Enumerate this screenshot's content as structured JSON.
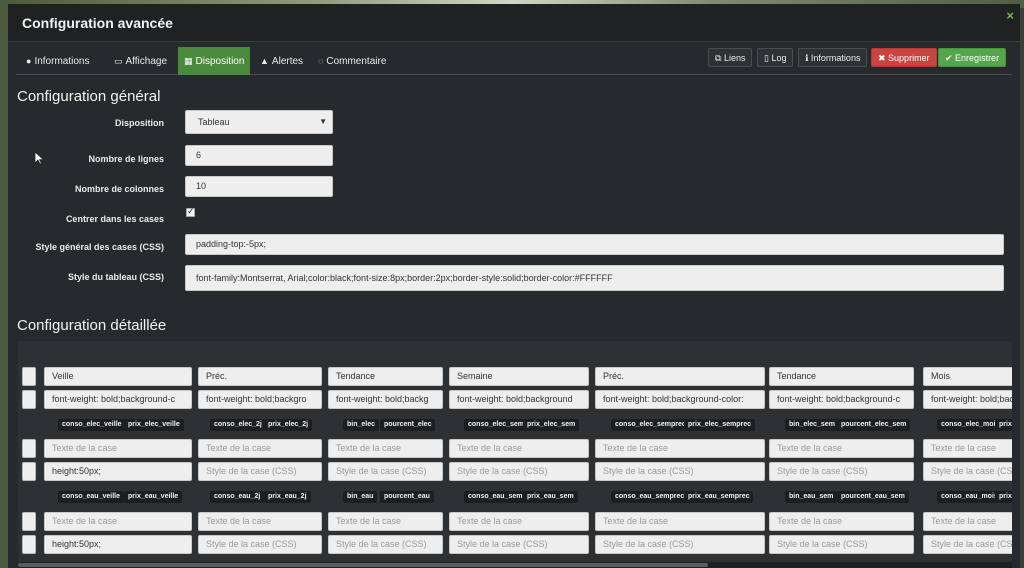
{
  "modal": {
    "title": "Configuration avancée",
    "close_glyph": "×"
  },
  "tabs": [
    {
      "icon": "info-circle-icon",
      "glyph": "●",
      "label": "Informations"
    },
    {
      "icon": "monitor-icon",
      "glyph": "▭",
      "label": "Affichage"
    },
    {
      "icon": "grid-icon",
      "glyph": "▦",
      "label": "Disposition"
    },
    {
      "icon": "warning-icon",
      "glyph": "▲",
      "label": "Alertes"
    },
    {
      "icon": "comment-icon",
      "glyph": "◌",
      "label": "Commentaire"
    }
  ],
  "active_tab": "Disposition",
  "actions": {
    "liens": "Liens",
    "log": "Log",
    "informations": "Informations",
    "supprimer": "Supprimer",
    "enregistrer": "Enregistrer"
  },
  "general": {
    "title": "Configuration général",
    "disposition_label": "Disposition",
    "disposition_value": "Tableau",
    "lignes_label": "Nombre de lignes",
    "lignes_value": "6",
    "colonnes_label": "Nombre de colonnes",
    "colonnes_value": "10",
    "centrer_label": "Centrer dans les cases",
    "centrer_checked": true,
    "style_cases_label": "Style général des cases (CSS)",
    "style_cases_value": "padding-top:-5px;",
    "style_tableau_label": "Style du tableau (CSS)",
    "style_tableau_value": "font-family:Montserrat, Arial;color:black;font-size:8px;border:2px;border-style:solid;border-color:#FFFFFF"
  },
  "detail": {
    "title": "Configuration détaillée",
    "placeholder_text": "Texte de la case",
    "placeholder_style": "Style de la case (CSS)",
    "headers": [
      "Veille",
      "Préc.",
      "Tendance",
      "Semaine",
      "Préc.",
      "Tendance",
      "Mois"
    ],
    "header_styles": [
      "font-weight: bold;background-c",
      "font-weight: bold;backgro",
      "font-weight: bold;backg",
      "font-weight: bold;background",
      "font-weight: bold;background-color:",
      "font-weight: bold;background-c",
      "font-weight: bold;background-c"
    ],
    "elec_tags": [
      [
        "conso_elec_veille",
        "prix_elec_veille"
      ],
      [
        "conso_elec_2j",
        "prix_elec_2j"
      ],
      [
        "bin_elec",
        "pourcent_elec"
      ],
      [
        "conso_elec_sem",
        "prix_elec_sem"
      ],
      [
        "conso_elec_semprec",
        "prix_elec_semprec"
      ],
      [
        "bin_elec_sem",
        "pourcent_elec_sem"
      ],
      [
        "conso_elec_mois",
        "prix"
      ]
    ],
    "eau_tags": [
      [
        "conso_eau_veille",
        "prix_eau_veille"
      ],
      [
        "conso_eau_2j",
        "prix_eau_2j"
      ],
      [
        "bin_eau",
        "pourcent_eau"
      ],
      [
        "conso_eau_sem",
        "prix_eau_sem"
      ],
      [
        "conso_eau_semprec",
        "prix_eau_semprec"
      ],
      [
        "bin_eau_sem",
        "pourcent_eau_sem"
      ],
      [
        "conso_eau_mois",
        "prix"
      ]
    ],
    "row_style_value": "height:50px;"
  }
}
